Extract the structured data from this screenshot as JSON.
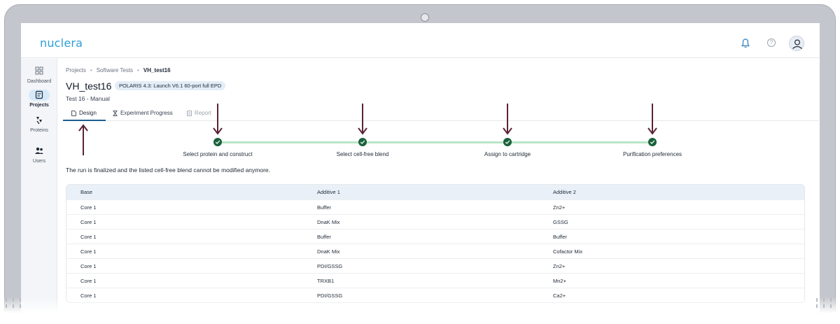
{
  "app": {
    "logo_text": "nuclera",
    "brand_color": "#2e9fd6",
    "accent_color": "#1d5e92"
  },
  "header": {
    "icons": [
      "bell-icon",
      "help-icon",
      "user-avatar-icon"
    ]
  },
  "sidebar": {
    "items": [
      {
        "label": "Dashboard",
        "icon": "dashboard-icon",
        "active": false
      },
      {
        "label": "Projects",
        "icon": "projects-icon",
        "active": true
      },
      {
        "label": "Proteins",
        "icon": "proteins-icon",
        "active": false
      },
      {
        "label": "Users",
        "icon": "users-icon",
        "active": false
      }
    ]
  },
  "breadcrumb": {
    "items": [
      "Projects",
      "Software Tests"
    ],
    "separator": "•",
    "current": "VH_test16"
  },
  "page": {
    "title": "VH_test16",
    "badge": "POLARIS 4.3: Launch V6.1 60-port full EPD",
    "subtitle": "Test 16 - Manual"
  },
  "tabs": [
    {
      "label": "Design",
      "icon": "document-icon",
      "state": "active"
    },
    {
      "label": "Experiment Progress",
      "icon": "hourglass-icon",
      "state": "enabled"
    },
    {
      "label": "Report",
      "icon": "report-icon",
      "state": "disabled"
    }
  ],
  "stepper": {
    "done_color": "#19613c",
    "line_color": "#b8e5c6",
    "steps": [
      {
        "label": "Select protein and construct",
        "done": true
      },
      {
        "label": "Select cell-free blend",
        "done": true
      },
      {
        "label": "Assign to cartridge",
        "done": true
      },
      {
        "label": "Purification preferences",
        "done": true
      }
    ]
  },
  "annotation_arrow_color": "#5a2238",
  "notice": "The run is finalized and the listed cell-free blend cannot be modified anymore.",
  "table": {
    "headers": [
      "Base",
      "Additive 1",
      "Additive 2"
    ],
    "rows": [
      [
        "Core 1",
        "Buffer",
        "Zn2+"
      ],
      [
        "Core 1",
        "DnaK Mix",
        "GSSG"
      ],
      [
        "Core 1",
        "Buffer",
        "Buffer"
      ],
      [
        "Core 1",
        "DnaK Mix",
        "Cofactor Mix"
      ],
      [
        "Core 1",
        "PDI/GSSG",
        "Zn2+"
      ],
      [
        "Core 1",
        "TRXB1",
        "Mn2+"
      ],
      [
        "Core 1",
        "PDI/GSSG",
        "Ca2+"
      ]
    ]
  }
}
